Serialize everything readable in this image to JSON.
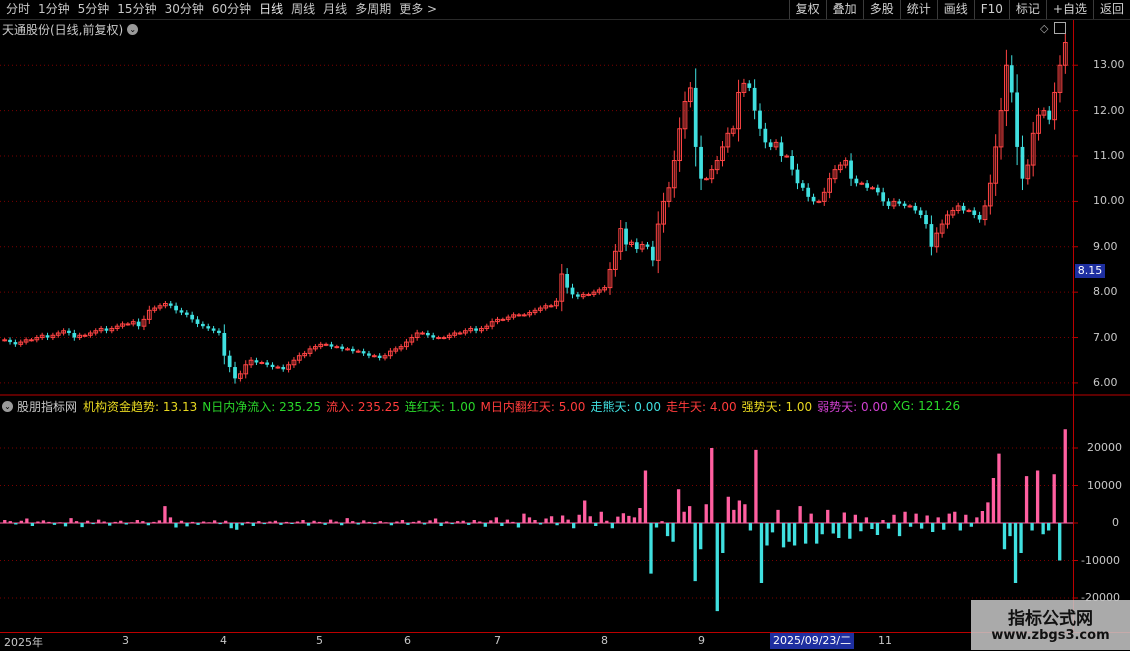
{
  "toolbar": {
    "periods": [
      "分时",
      "1分钟",
      "5分钟",
      "15分钟",
      "30分钟",
      "60分钟",
      "日线",
      "周线",
      "月线",
      "多周期",
      "更多 >"
    ],
    "active": "日线",
    "buttons": [
      "复权",
      "叠加",
      "多股",
      "统计",
      "画线",
      "F10",
      "标记",
      "+自选",
      "返回"
    ]
  },
  "title": "天通股份(日线,前复权)",
  "price_axis": [
    "13.00",
    "12.00",
    "11.00",
    "10.00",
    "9.00",
    "8.00",
    "7.00",
    "6.00"
  ],
  "current_price_tag": "8.15",
  "indicator": {
    "name": "股朋指标网",
    "items": [
      {
        "label": "机构资金趋势: 13.13",
        "color": "#e8d820"
      },
      {
        "label": "N日内净流入: 235.25",
        "color": "#2ad82a"
      },
      {
        "label": "流入: 235.25",
        "color": "#ff3c3c"
      },
      {
        "label": "连红天: 1.00",
        "color": "#2ad82a"
      },
      {
        "label": "M日内翻红天: 5.00",
        "color": "#ff3c3c"
      },
      {
        "label": "走熊天: 0.00",
        "color": "#40e0e0"
      },
      {
        "label": "走牛天: 4.00",
        "color": "#ff3c3c"
      },
      {
        "label": "强势天: 1.00",
        "color": "#e8d820"
      },
      {
        "label": "弱势天: 0.00",
        "color": "#d040d0"
      },
      {
        "label": "XG: 121.26",
        "color": "#2ad82a"
      }
    ]
  },
  "indicator_axis": [
    "20000",
    "10000",
    "0",
    "-10000",
    "-20000"
  ],
  "dates": [
    "2025年",
    "3",
    "4",
    "5",
    "6",
    "7",
    "8",
    "9",
    "11"
  ],
  "date_highlight": "2025/09/23/二",
  "watermark": {
    "title": "指标公式网",
    "url": "www.zbgs3.com"
  },
  "colors": {
    "up": "#ff4444",
    "down": "#40e0e0",
    "bar_pos": "#ff5fa0",
    "bar_neg": "#40e0e0",
    "grid": "#7a0000"
  },
  "chart_data": [
    {
      "type": "candlestick",
      "title": "天通股份(日线,前复权)",
      "ylim": [
        5.8,
        13.6
      ],
      "closes": [
        6.95,
        6.9,
        6.85,
        6.9,
        6.95,
        6.95,
        7.0,
        7.05,
        7.0,
        7.05,
        7.1,
        7.15,
        7.1,
        7.0,
        7.05,
        7.05,
        7.1,
        7.15,
        7.2,
        7.15,
        7.2,
        7.25,
        7.3,
        7.3,
        7.35,
        7.25,
        7.4,
        7.6,
        7.65,
        7.7,
        7.75,
        7.7,
        7.6,
        7.55,
        7.5,
        7.4,
        7.3,
        7.25,
        7.2,
        7.15,
        7.1,
        6.6,
        6.35,
        6.1,
        6.2,
        6.4,
        6.5,
        6.45,
        6.45,
        6.4,
        6.35,
        6.35,
        6.3,
        6.4,
        6.5,
        6.6,
        6.65,
        6.75,
        6.8,
        6.85,
        6.85,
        6.8,
        6.8,
        6.75,
        6.75,
        6.7,
        6.7,
        6.65,
        6.6,
        6.6,
        6.55,
        6.6,
        6.7,
        6.75,
        6.8,
        6.9,
        7.0,
        7.1,
        7.1,
        7.05,
        7.0,
        7.0,
        7.0,
        7.05,
        7.1,
        7.1,
        7.15,
        7.2,
        7.15,
        7.2,
        7.25,
        7.35,
        7.4,
        7.4,
        7.45,
        7.5,
        7.5,
        7.5,
        7.55,
        7.6,
        7.65,
        7.7,
        7.7,
        7.8,
        8.4,
        8.1,
        7.95,
        7.9,
        7.95,
        7.95,
        8.0,
        8.05,
        8.1,
        8.5,
        8.9,
        9.4,
        9.05,
        9.1,
        8.95,
        9.05,
        9.0,
        8.7,
        9.5,
        10.0,
        10.3,
        10.9,
        11.6,
        12.2,
        12.5,
        11.2,
        10.5,
        10.5,
        10.7,
        10.9,
        11.2,
        11.5,
        11.6,
        12.4,
        12.6,
        12.5,
        12.0,
        11.6,
        11.3,
        11.2,
        11.3,
        11.0,
        11.0,
        10.7,
        10.4,
        10.3,
        10.1,
        10.0,
        10.0,
        10.2,
        10.5,
        10.7,
        10.8,
        10.9,
        10.5,
        10.4,
        10.4,
        10.3,
        10.3,
        10.2,
        10.0,
        9.9,
        10.0,
        9.95,
        9.9,
        9.9,
        9.8,
        9.7,
        9.5,
        9.0,
        9.3,
        9.5,
        9.7,
        9.8,
        9.9,
        9.8,
        9.8,
        9.7,
        9.6,
        9.9,
        10.4,
        11.2,
        12.0,
        13.0,
        12.4,
        11.2,
        10.5,
        10.8,
        11.5,
        11.9,
        12.0,
        11.8,
        12.4,
        13.0,
        13.5
      ],
      "ylabel": ""
    },
    {
      "type": "bar",
      "title": "股朋指标网",
      "ylim": [
        -28000,
        28000
      ],
      "values": [
        800,
        500,
        -400,
        600,
        1200,
        -800,
        400,
        700,
        300,
        -500,
        200,
        -900,
        1300,
        500,
        -1100,
        600,
        -300,
        900,
        400,
        -700,
        300,
        600,
        -400,
        200,
        800,
        500,
        -600,
        300,
        700,
        4500,
        1500,
        -1200,
        600,
        -900,
        300,
        -500,
        400,
        200,
        700,
        -300,
        600,
        -1400,
        -1800,
        -600,
        300,
        -800,
        500,
        -300,
        400,
        600,
        -500,
        300,
        -200,
        400,
        800,
        -700,
        600,
        300,
        -500,
        900,
        400,
        -600,
        1300,
        500,
        -400,
        700,
        300,
        -300,
        500,
        200,
        -600,
        400,
        800,
        -500,
        300,
        600,
        -400,
        700,
        1200,
        -800,
        400,
        -300,
        500,
        600,
        -500,
        800,
        400,
        -1000,
        700,
        1500,
        -800,
        900,
        300,
        -1200,
        2500,
        1500,
        800,
        -400,
        1200,
        1800,
        -600,
        2000,
        900,
        -1400,
        2200,
        6000,
        1800,
        -800,
        3000,
        600,
        -1400,
        1700,
        2600,
        1900,
        1500,
        4000,
        14000,
        -13500,
        -1200,
        500,
        -3500,
        -5000,
        9000,
        3000,
        4500,
        -15500,
        -7000,
        5000,
        20000,
        -23500,
        -8000,
        7000,
        3500,
        6000,
        5000,
        -2000,
        19500,
        -16000,
        -6000,
        -2500,
        3500,
        -6500,
        -5000,
        -6000,
        4500,
        -5500,
        2500,
        -5500,
        -3000,
        3500,
        -2800,
        -4000,
        2800,
        -4200,
        2200,
        -2200,
        1500,
        -1600,
        -3200,
        800,
        -1500,
        2200,
        -3500,
        3000,
        -1000,
        2500,
        -1500,
        2000,
        -2400,
        1500,
        -1800,
        2500,
        3000,
        -2000,
        2200,
        -1000,
        1500,
        3200,
        5500,
        12000,
        18500,
        -7000,
        -3500,
        -16000,
        -8000,
        12500,
        -2000,
        14000,
        -3000,
        -2000,
        13000,
        -10000,
        25000
      ]
    }
  ]
}
